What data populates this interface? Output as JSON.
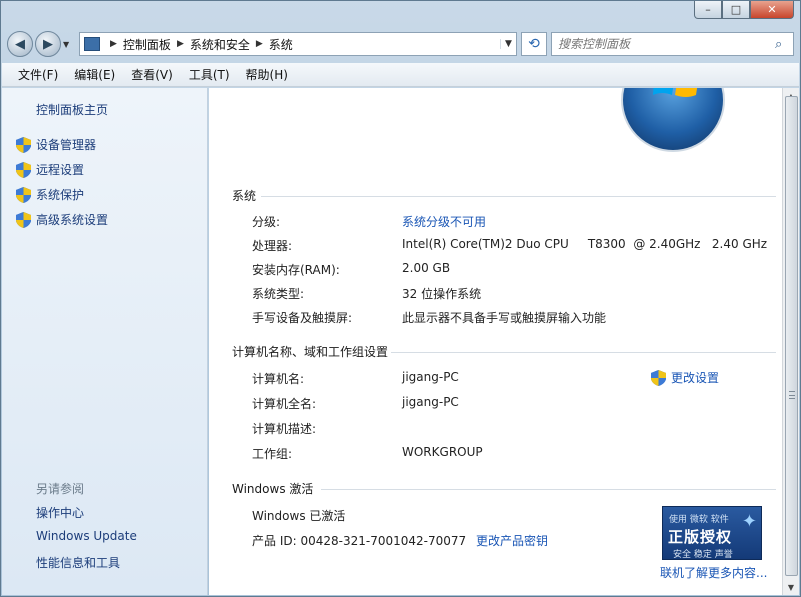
{
  "window": {
    "caption": {
      "minimize": "–",
      "maximize": "□",
      "close": "✕"
    }
  },
  "nav": {
    "back_icon": "back-arrow-icon",
    "forward_icon": "forward-arrow-icon",
    "breadcrumb": [
      "控制面板",
      "系统和安全",
      "系统"
    ],
    "search_placeholder": "搜索控制面板"
  },
  "menubar": [
    "文件(F)",
    "编辑(E)",
    "查看(V)",
    "工具(T)",
    "帮助(H)"
  ],
  "sidebar": {
    "home": "控制面板主页",
    "tasks": [
      "设备管理器",
      "远程设置",
      "系统保护",
      "高级系统设置"
    ],
    "see_also_title": "另请参阅",
    "see_also": [
      "操作中心",
      "Windows Update",
      "性能信息和工具"
    ]
  },
  "system": {
    "title": "系统",
    "rows": [
      {
        "label": "分级:",
        "value": "系统分级不可用",
        "link": true
      },
      {
        "label": "处理器:",
        "value": "Intel(R) Core(TM)2 Duo CPU     T8300  @ 2.40GHz   2.40 GHz",
        "link": false
      },
      {
        "label": "安装内存(RAM):",
        "value": "2.00 GB",
        "link": false
      },
      {
        "label": "系统类型:",
        "value": "32 位操作系统",
        "link": false
      },
      {
        "label": "手写设备及触摸屏:",
        "value": "此显示器不具备手写或触摸屏输入功能",
        "link": false
      }
    ]
  },
  "computer": {
    "title": "计算机名称、域和工作组设置",
    "change_settings": "更改设置",
    "rows": [
      {
        "label": "计算机名:",
        "value": "jigang-PC"
      },
      {
        "label": "计算机全名:",
        "value": "jigang-PC"
      },
      {
        "label": "计算机描述:",
        "value": ""
      },
      {
        "label": "工作组:",
        "value": "WORKGROUP"
      }
    ]
  },
  "activation": {
    "title": "Windows 激活",
    "status": "Windows 已激活",
    "product_id_label": "产品 ID: 00428-321-7001042-70077",
    "change_key": "更改产品密钥",
    "badge_top": "使用 微软 软件",
    "badge_main": "正版授权",
    "badge_sub": "安全 稳定 声誉",
    "learn_more": "联机了解更多内容..."
  },
  "colors": {
    "link": "#1a56b5",
    "sidebar_link": "#1c3d7a",
    "pane_bg": "#eef4fa"
  }
}
